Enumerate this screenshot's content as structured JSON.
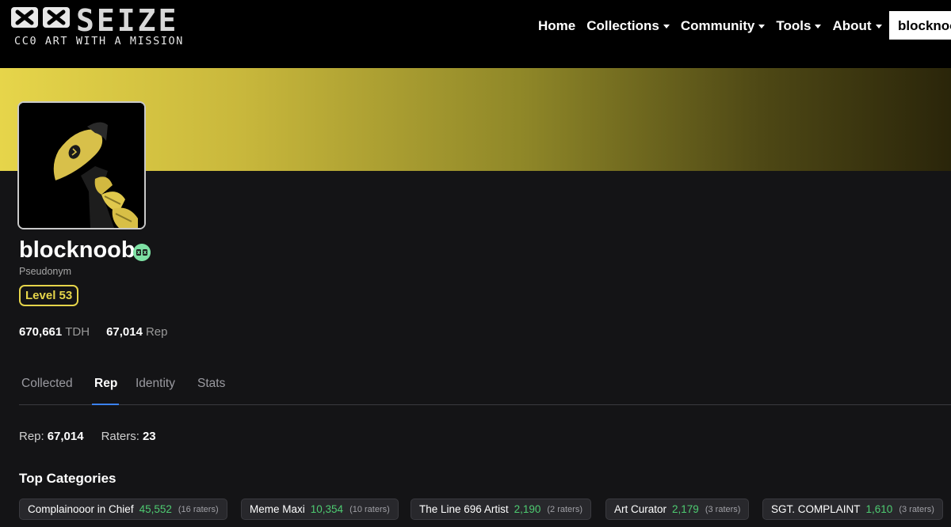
{
  "header": {
    "logo_word": "SEIZE",
    "logo_tagline": "CC0 ART WITH A MISSION",
    "nav": [
      {
        "label": "Home",
        "has_caret": false
      },
      {
        "label": "Collections",
        "has_caret": true
      },
      {
        "label": "Community",
        "has_caret": true
      },
      {
        "label": "Tools",
        "has_caret": true
      },
      {
        "label": "About",
        "has_caret": true
      }
    ],
    "user_button": "blocknoob"
  },
  "colors": {
    "accent": "#e6d54a",
    "banner_start": "#e6d54a",
    "banner_end": "#2a250a",
    "positive": "#4ecb71",
    "tab_active": "#3b82f6",
    "verify": "#7ee0a4"
  },
  "profile": {
    "handle": "blocknoob",
    "subtitle": "Pseudonym",
    "level": "Level 53",
    "tdh_value": "670,661",
    "tdh_unit": "TDH",
    "rep_value": "67,014",
    "rep_unit": "Rep"
  },
  "tabs": [
    "Collected",
    "Rep",
    "Identity",
    "Stats"
  ],
  "active_tab": "Rep",
  "rep": {
    "rep_label": "Rep:",
    "rep_value": "67,014",
    "raters_label": "Raters:",
    "raters_value": "23"
  },
  "top_categories": {
    "title": "Top Categories",
    "items": [
      {
        "name": "Complainooor in Chief",
        "score": "45,552",
        "raters": "(16 raters)"
      },
      {
        "name": "Meme Maxi",
        "score": "10,354",
        "raters": "(10 raters)"
      },
      {
        "name": "The Line 696 Artist",
        "score": "2,190",
        "raters": "(2 raters)"
      },
      {
        "name": "Art Curator",
        "score": "2,179",
        "raters": "(3 raters)"
      },
      {
        "name": "SGT. COMPLAINT",
        "score": "1,610",
        "raters": "(3 raters)"
      }
    ]
  },
  "icons": [
    "seize-logo-icon",
    "verified-badge-icon",
    "caret-down-icon",
    "avatar-image"
  ]
}
